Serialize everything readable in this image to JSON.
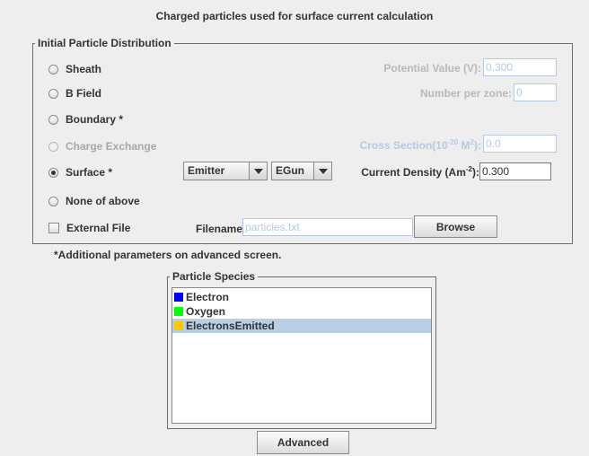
{
  "dialog_title": "Charged particles used for surface current calculation",
  "distribution": {
    "legend": "Initial Particle Distribution",
    "options": [
      {
        "label": "Sheath",
        "selected": false,
        "enabled": true
      },
      {
        "label": "B Field",
        "selected": false,
        "enabled": true
      },
      {
        "label": "Boundary *",
        "selected": false,
        "enabled": true
      },
      {
        "label": "Charge Exchange",
        "selected": false,
        "enabled": false
      },
      {
        "label": "Surface *",
        "selected": true,
        "enabled": true
      },
      {
        "label": "None of above",
        "selected": false,
        "enabled": true
      }
    ],
    "potential_label": "Potential Value (V):",
    "potential_value": "0.300",
    "number_label": "Number per zone:",
    "number_value": "0",
    "cross_section_label_pre": "Cross Section(10",
    "cross_section_exp": "-20",
    "cross_section_label_mid": " M",
    "cross_section_exp2": "2",
    "cross_section_label_post": "):",
    "cross_section_value": "0.0",
    "emitter_combo": "Emitter",
    "egun_combo": "EGun",
    "current_density_label_pre": "Current Density (Am",
    "current_density_exp": "-2",
    "current_density_label_post": "):",
    "current_density_value": "0.300",
    "external_file_label": "External File",
    "external_file_checked": false,
    "filename_label": "Filename:",
    "filename_value": "particles.txt",
    "browse_label": "Browse"
  },
  "note": "*Additional parameters on advanced screen.",
  "species": {
    "legend": "Particle Species",
    "items": [
      {
        "label": "Electron",
        "color": "#0000ff",
        "selected": false
      },
      {
        "label": "Oxygen",
        "color": "#00ff00",
        "selected": false
      },
      {
        "label": "ElectronsEmitted",
        "color": "#ffc800",
        "selected": true
      }
    ]
  },
  "advanced_label": "Advanced"
}
